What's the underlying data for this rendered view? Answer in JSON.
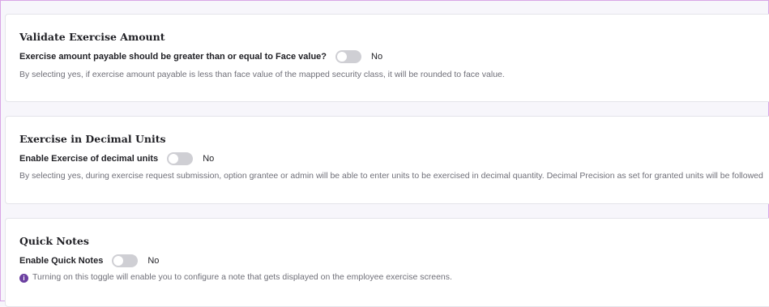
{
  "sections": [
    {
      "title": "Validate Exercise Amount",
      "toggle_label": "Exercise amount payable should be greater than or equal to Face value?",
      "toggle_state": "No",
      "description": "By selecting yes, if exercise amount payable is less than face value of the mapped security class, it will be rounded to face value."
    },
    {
      "title": "Exercise in Decimal Units",
      "toggle_label": "Enable Exercise of decimal units",
      "toggle_state": "No",
      "description": "By selecting yes, during exercise request submission, option grantee or admin will be able to enter units to be exercised in decimal quantity. Decimal Precision as set for granted units will be followed"
    },
    {
      "title": "Quick Notes",
      "toggle_label": "Enable Quick Notes",
      "toggle_state": "No",
      "description": "Turning on this toggle will enable you to configure a note that gets displayed on the employee exercise screens.",
      "icon": "info-icon"
    }
  ],
  "colors": {
    "toggle_off": "#cfcfd4",
    "info_icon": "#6b3fa0"
  }
}
